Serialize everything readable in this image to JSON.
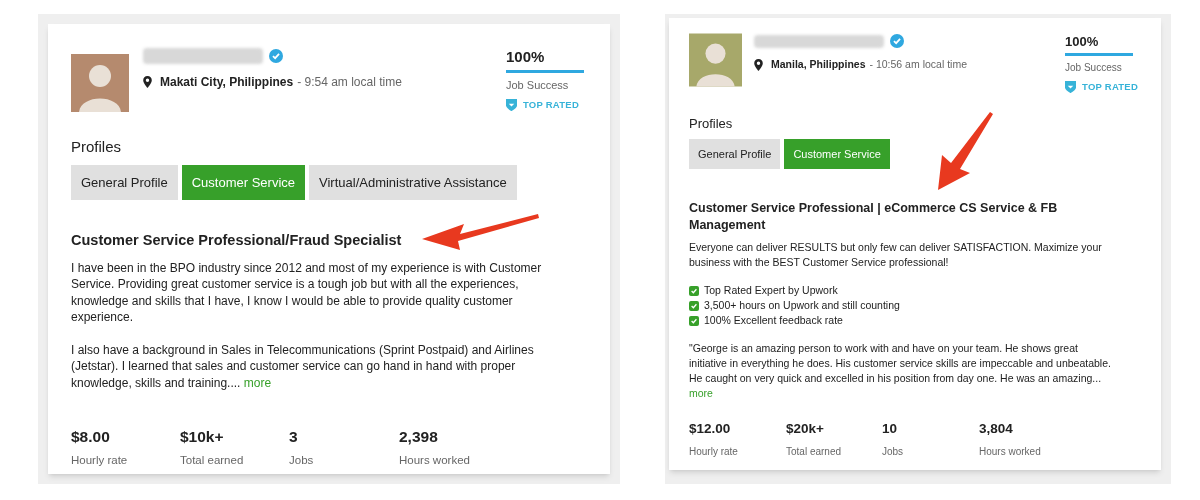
{
  "cards": [
    {
      "location": "Makati City, Philippines",
      "local_time": "- 9:54 am local time",
      "job_success": {
        "value": "100%",
        "label": "Job Success",
        "level": 1
      },
      "badge": "TOP RATED",
      "profiles_heading": "Profiles",
      "profiles": [
        {
          "label": "General Profile",
          "selected": false
        },
        {
          "label": "Customer Service",
          "selected": true
        },
        {
          "label": "Virtual/Administrative Assistance",
          "selected": false
        }
      ],
      "title": "Customer Service Professional/Fraud Specialist",
      "body": [
        {
          "kind": "paragraph",
          "text": "I have been in the BPO industry since 2012 and most of my experience is with Customer Service. Providing great customer service is a tough job but with all the experiences, knowledge and skills that I have, I know I would be able to provide quality customer experience."
        },
        {
          "kind": "paragraph",
          "text": "I also have a background in Sales in Telecommunications (Sprint Postpaid) and Airlines (Jetstar). I learned that sales and customer service can go hand in hand with proper knowledge, skills and training....",
          "more": "more"
        }
      ],
      "stats": [
        {
          "value": "$8.00",
          "label": "Hourly rate"
        },
        {
          "value": "$10k+",
          "label": "Total earned"
        },
        {
          "value": "3",
          "label": "Jobs"
        },
        {
          "value": "2,398",
          "label": "Hours worked"
        }
      ]
    },
    {
      "location": "Manila, Philippines",
      "local_time": "- 10:56 am local time",
      "job_success": {
        "value": "100%",
        "label": "Job Success",
        "level": 1
      },
      "badge": "TOP RATED",
      "profiles_heading": "Profiles",
      "profiles": [
        {
          "label": "General Profile",
          "selected": false
        },
        {
          "label": "Customer Service",
          "selected": true
        }
      ],
      "title": "Customer Service Professional | eCommerce CS Service & FB Management",
      "body": [
        {
          "kind": "paragraph",
          "text": "Everyone can deliver RESULTS but only few can deliver SATISFACTION. Maximize your business with the BEST Customer Service professional!"
        },
        {
          "kind": "checklist",
          "items": [
            {
              "text": "Top Rated Expert by Upwork",
              "checked": true
            },
            {
              "text": "3,500+ hours on Upwork and still counting",
              "checked": true
            },
            {
              "text": "100% Excellent feedback rate",
              "checked": true
            }
          ]
        },
        {
          "kind": "paragraph",
          "text": "\"George is an amazing person to work with and have on your team. He shows great initiative in everything he does. His customer service skills are impeccable and unbeatable. He caught on very quick and excelled in his position from day one. He was an amazing...",
          "more": "more"
        }
      ],
      "stats": [
        {
          "value": "$12.00",
          "label": "Hourly rate"
        },
        {
          "value": "$20k+",
          "label": "Total earned"
        },
        {
          "value": "10",
          "label": "Jobs"
        },
        {
          "value": "3,804",
          "label": "Hours worked"
        }
      ]
    }
  ]
}
